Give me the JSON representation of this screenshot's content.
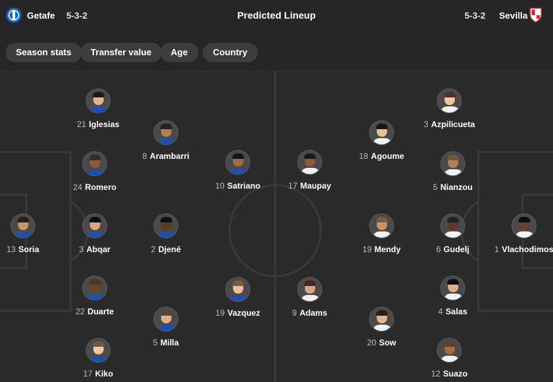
{
  "header": {
    "title": "Predicted Lineup",
    "home": {
      "name": "Getafe",
      "formation": "5-3-2",
      "crest_icon": "getafe-crest-icon",
      "crest_color": "#1565c0"
    },
    "away": {
      "name": "Sevilla",
      "formation": "5-3-2",
      "crest_icon": "sevilla-crest-icon",
      "crest_color": "#d32f2f"
    }
  },
  "filters": [
    "Season stats",
    "Transfer value",
    "Age",
    "Country"
  ],
  "home_players": [
    {
      "number": "13",
      "name": "Soria"
    },
    {
      "number": "21",
      "name": "Iglesias"
    },
    {
      "number": "24",
      "name": "Romero"
    },
    {
      "number": "3",
      "name": "Abqar"
    },
    {
      "number": "22",
      "name": "Duarte"
    },
    {
      "number": "17",
      "name": "Kiko"
    },
    {
      "number": "8",
      "name": "Arambarri"
    },
    {
      "number": "2",
      "name": "Djené"
    },
    {
      "number": "5",
      "name": "Milla"
    },
    {
      "number": "10",
      "name": "Satriano"
    },
    {
      "number": "19",
      "name": "Vazquez"
    }
  ],
  "away_players": [
    {
      "number": "1",
      "name": "Vlachodimos"
    },
    {
      "number": "3",
      "name": "Azpilicueta"
    },
    {
      "number": "5",
      "name": "Nianzou"
    },
    {
      "number": "6",
      "name": "Gudelj"
    },
    {
      "number": "4",
      "name": "Salas"
    },
    {
      "number": "12",
      "name": "Suazo"
    },
    {
      "number": "18",
      "name": "Agoume"
    },
    {
      "number": "19",
      "name": "Mendy"
    },
    {
      "number": "20",
      "name": "Sow"
    },
    {
      "number": "17",
      "name": "Maupay"
    },
    {
      "number": "9",
      "name": "Adams"
    }
  ],
  "colors": {
    "background": "#262626",
    "chip": "#3d3d3d",
    "pitch_lines": "#3a3a3a"
  }
}
